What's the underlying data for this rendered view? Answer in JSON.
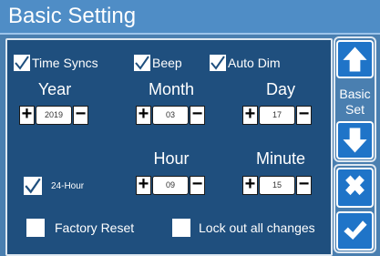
{
  "header": {
    "title": "Basic Setting"
  },
  "time_syncs": {
    "label": "Time Syncs",
    "checked": true
  },
  "beep": {
    "label": "Beep",
    "checked": true
  },
  "auto_dim": {
    "label": "Auto Dim",
    "checked": true
  },
  "year": {
    "label": "Year",
    "value": "2019"
  },
  "month": {
    "label": "Month",
    "value": "03"
  },
  "day": {
    "label": "Day",
    "value": "17"
  },
  "hour": {
    "label": "Hour",
    "value": "09"
  },
  "minute": {
    "label": "Minute",
    "value": "15"
  },
  "hour24": {
    "label": "24-Hour",
    "checked": true
  },
  "factory_reset": {
    "label": "Factory Reset",
    "checked": false
  },
  "lock_out": {
    "label": "Lock out all changes",
    "checked": false
  },
  "sidebar": {
    "page_label_line1": "Basic",
    "page_label_line2": "Set",
    "icons": [
      "up-arrow-icon",
      "down-arrow-icon",
      "close-icon",
      "check-icon"
    ]
  },
  "colors": {
    "background": "#4a7fb0",
    "panel": "#1f4f7e",
    "button": "#1f74c8"
  }
}
